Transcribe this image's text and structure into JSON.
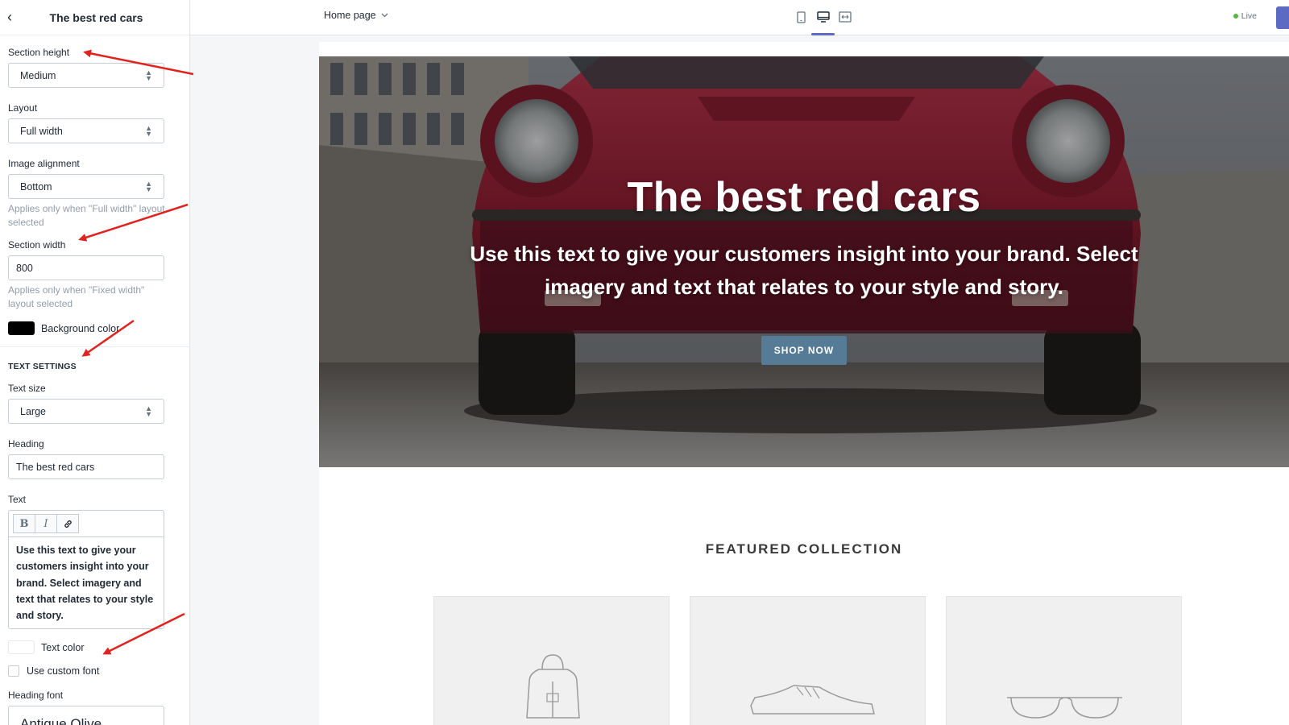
{
  "sidebar": {
    "title": "The best red cars",
    "section_height": {
      "label": "Section height",
      "value": "Medium"
    },
    "layout": {
      "label": "Layout",
      "value": "Full width"
    },
    "image_alignment": {
      "label": "Image alignment",
      "value": "Bottom",
      "help": "Applies only when \"Full width\" layout selected"
    },
    "section_width": {
      "label": "Section width",
      "value": "800",
      "help": "Applies only when \"Fixed width\" layout selected"
    },
    "background_color": {
      "label": "Background color",
      "color": "#000000"
    },
    "text_settings_title": "TEXT SETTINGS",
    "text_size": {
      "label": "Text size",
      "value": "Large"
    },
    "heading": {
      "label": "Heading",
      "value": "The best red cars"
    },
    "text": {
      "label": "Text",
      "value": "Use this text to give your customers insight into your brand. Select imagery and text that relates to your style and story.",
      "toolbar": [
        "bold-icon",
        "italic-icon",
        "link-icon"
      ]
    },
    "text_color": {
      "label": "Text color",
      "color": "#ffffff"
    },
    "use_custom_font": {
      "label": "Use custom font",
      "checked": false
    },
    "heading_font": {
      "label": "Heading font",
      "value": "Antique Olive"
    }
  },
  "topbar": {
    "page_select": "Home page",
    "devices": [
      "mobile-icon",
      "desktop-icon",
      "fullscreen-icon"
    ],
    "active_device": "desktop-icon",
    "status": "Live"
  },
  "preview": {
    "hero": {
      "heading": "The best red cars",
      "text": "Use this text to give your customers insight into your brand. Select imagery and text that relates to your style and story.",
      "button": "SHOP NOW"
    },
    "featured_title": "FEATURED COLLECTION",
    "products": [
      "backpack-icon",
      "shoe-icon",
      "sunglasses-icon"
    ]
  },
  "colors": {
    "accent": "#5c6ac4",
    "button": "#557b97",
    "annotation": "#e0231e",
    "live": "#50b83c"
  }
}
